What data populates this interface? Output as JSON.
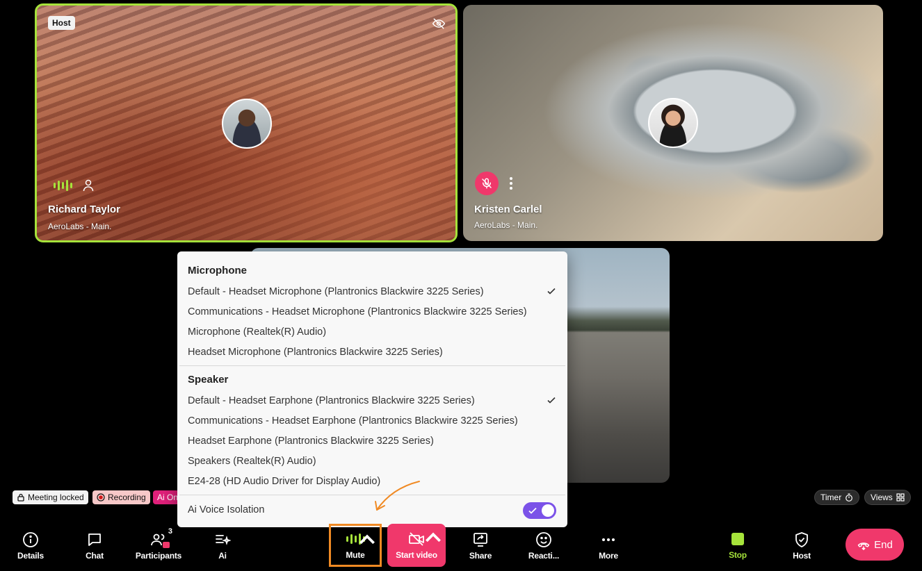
{
  "tiles": [
    {
      "badge": "Host",
      "name": "Richard Taylor",
      "org": "AeroLabs - Main."
    },
    {
      "name": "Kristen Carlel",
      "org": "AeroLabs - Main."
    }
  ],
  "status": {
    "meeting_locked": "Meeting locked",
    "recording": "Recording",
    "ai": "Ai On",
    "timer": "Timer",
    "views": "Views"
  },
  "audio_menu": {
    "microphone_heading": "Microphone",
    "microphones": [
      "Default - Headset Microphone (Plantronics Blackwire 3225 Series)",
      "Communications - Headset Microphone (Plantronics Blackwire 3225 Series)",
      "Microphone (Realtek(R) Audio)",
      "Headset Microphone (Plantronics Blackwire 3225 Series)"
    ],
    "selected_microphone_index": 0,
    "speaker_heading": "Speaker",
    "speakers": [
      "Default - Headset Earphone (Plantronics Blackwire 3225 Series)",
      "Communications - Headset Earphone (Plantronics Blackwire 3225 Series)",
      "Headset Earphone (Plantronics Blackwire 3225 Series)",
      "Speakers (Realtek(R) Audio)",
      "E24-28 (HD Audio Driver for Display Audio)"
    ],
    "selected_speaker_index": 0,
    "voice_isolation_label": "Ai Voice Isolation",
    "voice_isolation_on": true,
    "toggle_color": "#7b52e8"
  },
  "toolbar": {
    "details": "Details",
    "chat": "Chat",
    "participants": "Participants",
    "participants_count": "3",
    "ai": "Ai",
    "mute": "Mute",
    "start_video": "Start video",
    "share": "Share",
    "reactions": "Reacti...",
    "more": "More",
    "stop": "Stop",
    "host": "Host",
    "end": "End"
  },
  "colors": {
    "active_speaker_border": "#a6e33b",
    "danger": "#f0386b",
    "highlight_box": "#f08a24"
  }
}
